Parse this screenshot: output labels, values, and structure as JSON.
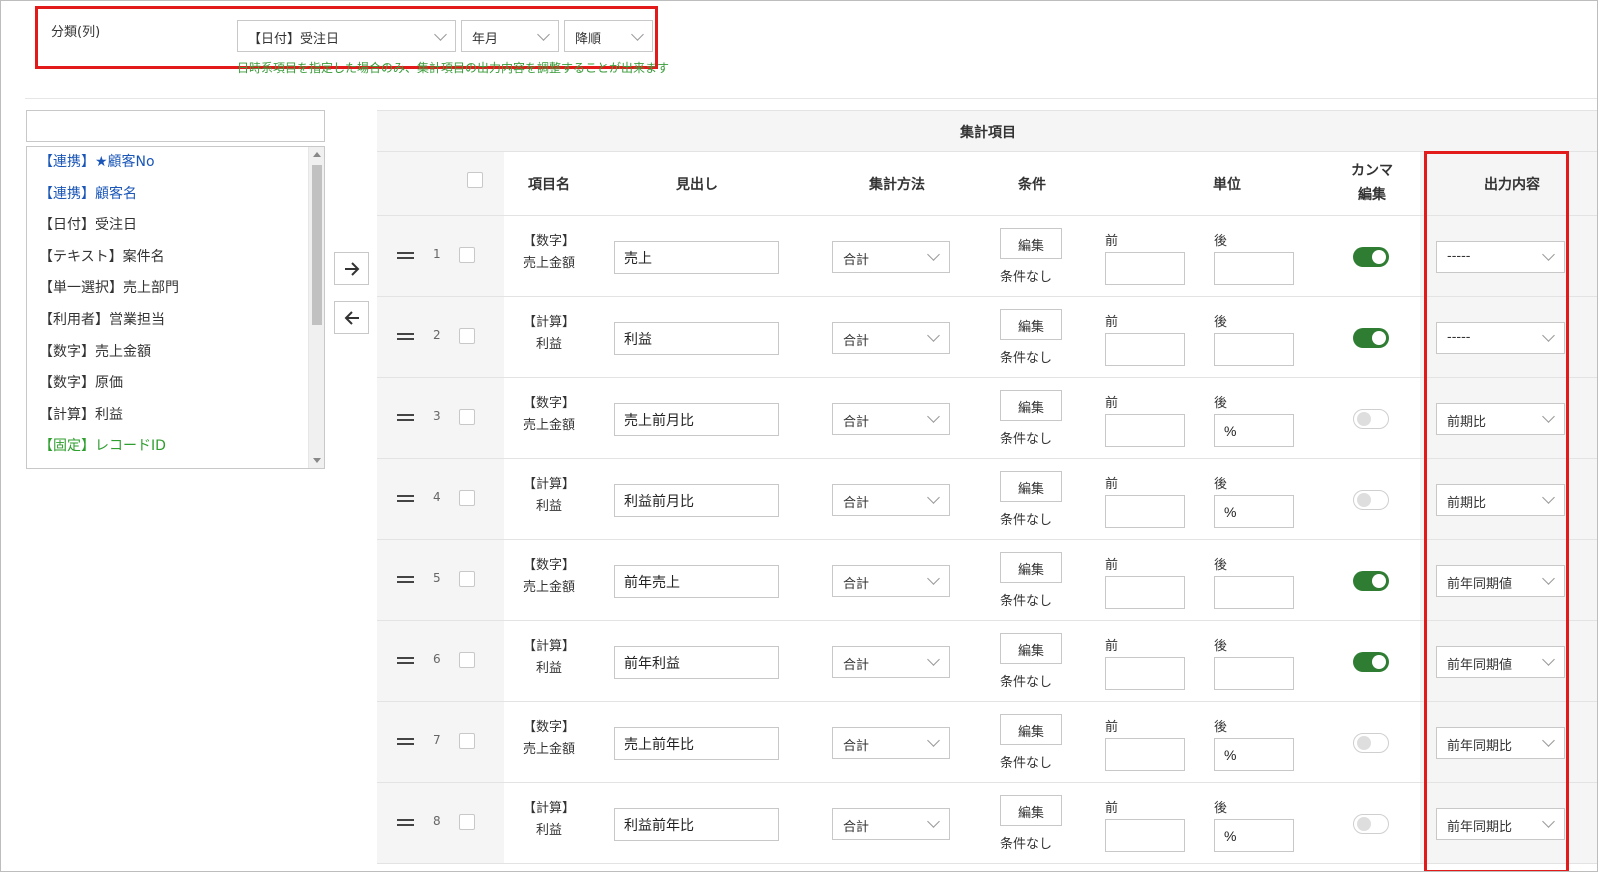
{
  "classification": {
    "label": "分類(列)",
    "field_select": "【日付】受注日",
    "unit_select": "年月",
    "order_select": "降順",
    "hint": "日時系項目を指定した場合のみ、集計項目の出力内容を調整することが出来ます"
  },
  "field_list": {
    "search_value": "",
    "items": [
      {
        "label": "【連携】★顧客No",
        "color": "#1a56b8"
      },
      {
        "label": "【連携】顧客名",
        "color": "#1a56b8"
      },
      {
        "label": "【日付】受注日",
        "color": "#333333"
      },
      {
        "label": "【テキスト】案件名",
        "color": "#333333"
      },
      {
        "label": "【単一選択】売上部門",
        "color": "#333333"
      },
      {
        "label": "【利用者】営業担当",
        "color": "#333333"
      },
      {
        "label": "【数字】売上金額",
        "color": "#333333"
      },
      {
        "label": "【数字】原価",
        "color": "#333333"
      },
      {
        "label": "【計算】利益",
        "color": "#333333"
      },
      {
        "label": "【固定】レコードID",
        "color": "#2e9e2e"
      }
    ]
  },
  "move_buttons": {
    "right_icon": "arrow-right-icon",
    "left_icon": "arrow-left-icon"
  },
  "table": {
    "title": "集計項目",
    "headers": {
      "item_name": "項目名",
      "heading": "見出し",
      "method": "集計方法",
      "condition": "条件",
      "unit": "単位",
      "comma_line1": "カンマ",
      "comma_line2": "編集",
      "output": "出力内容"
    },
    "edit_label": "編集",
    "no_condition": "条件なし",
    "unit_before": "前",
    "unit_after": "後",
    "rows": [
      {
        "num": "1",
        "type": "【数字】",
        "field": "売上金額",
        "heading": "売上",
        "method": "合計",
        "before": "",
        "after": "",
        "comma": true,
        "output": "-----"
      },
      {
        "num": "2",
        "type": "【計算】",
        "field": "利益",
        "heading": "利益",
        "method": "合計",
        "before": "",
        "after": "",
        "comma": true,
        "output": "-----"
      },
      {
        "num": "3",
        "type": "【数字】",
        "field": "売上金額",
        "heading": "売上前月比",
        "method": "合計",
        "before": "",
        "after": "%",
        "comma": false,
        "output": "前期比"
      },
      {
        "num": "4",
        "type": "【計算】",
        "field": "利益",
        "heading": "利益前月比",
        "method": "合計",
        "before": "",
        "after": "%",
        "comma": false,
        "output": "前期比"
      },
      {
        "num": "5",
        "type": "【数字】",
        "field": "売上金額",
        "heading": "前年売上",
        "method": "合計",
        "before": "",
        "after": "",
        "comma": true,
        "output": "前年同期値"
      },
      {
        "num": "6",
        "type": "【計算】",
        "field": "利益",
        "heading": "前年利益",
        "method": "合計",
        "before": "",
        "after": "",
        "comma": true,
        "output": "前年同期値"
      },
      {
        "num": "7",
        "type": "【数字】",
        "field": "売上金額",
        "heading": "売上前年比",
        "method": "合計",
        "before": "",
        "after": "%",
        "comma": false,
        "output": "前年同期比"
      },
      {
        "num": "8",
        "type": "【計算】",
        "field": "利益",
        "heading": "利益前年比",
        "method": "合計",
        "before": "",
        "after": "%",
        "comma": false,
        "output": "前年同期比"
      }
    ]
  },
  "colors": {
    "highlight": "#e21a1a",
    "toggle_on": "#2f7d32",
    "hint": "#3a9c3a",
    "link": "#1a56b8",
    "fixed": "#2e9e2e"
  }
}
